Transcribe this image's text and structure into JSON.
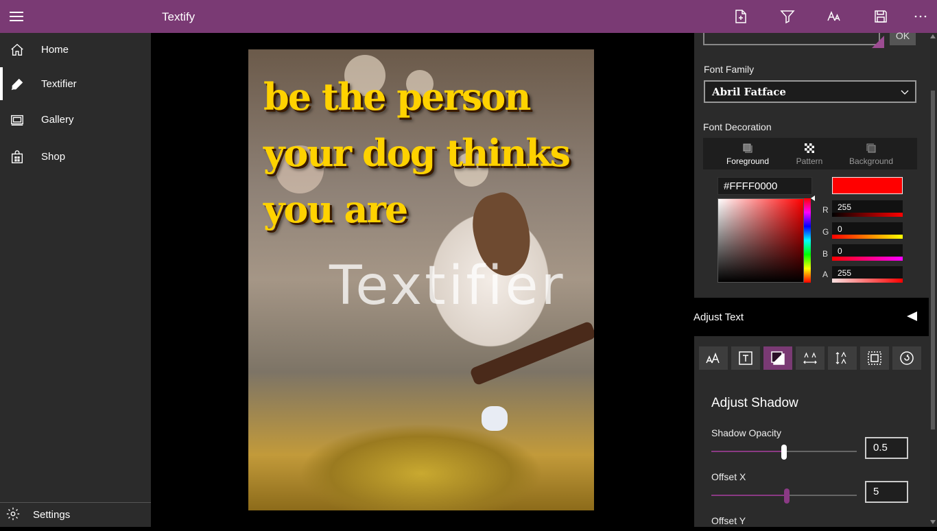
{
  "titlebar": {
    "app_title": "Textify",
    "actions": [
      "new-file-icon",
      "filter-icon",
      "text-style-icon",
      "save-icon",
      "more-icon"
    ],
    "color": "#7a3a74"
  },
  "sidebar": {
    "items": [
      {
        "label": "Home",
        "icon": "home-icon"
      },
      {
        "label": "Textifier",
        "icon": "pen-icon",
        "active": true
      },
      {
        "label": "Gallery",
        "icon": "gallery-icon"
      },
      {
        "label": "Shop",
        "icon": "shop-icon"
      }
    ],
    "settings_label": "Settings"
  },
  "canvas": {
    "quote_lines": [
      "be the person",
      "your dog thinks",
      "you are"
    ],
    "watermark": "Textifier"
  },
  "panel": {
    "ok_label": "OK",
    "font_family_label": "Font Family",
    "font_family_value": "Abril Fatface",
    "font_decoration_label": "Font Decoration",
    "decoration_tabs": [
      {
        "label": "Foreground",
        "active": true
      },
      {
        "label": "Pattern"
      },
      {
        "label": "Background"
      }
    ],
    "hex_value": "#FFFF0000",
    "swatch_color": "#ff0000",
    "channels": [
      {
        "label": "R",
        "value": "255"
      },
      {
        "label": "G",
        "value": "0"
      },
      {
        "label": "B",
        "value": "0"
      },
      {
        "label": "A",
        "value": "255"
      }
    ],
    "adjust_text_label": "Adjust Text",
    "tools": [
      "font-size-icon",
      "text-box-icon",
      "shadow-icon",
      "letter-spacing-icon",
      "line-spacing-icon",
      "border-icon",
      "rotate-icon"
    ],
    "active_tool_index": 2,
    "section_title": "Adjust Shadow",
    "shadow_opacity_label": "Shadow Opacity",
    "shadow_opacity_value": "0.5",
    "shadow_opacity_level": 0.5,
    "offset_x_label": "Offset X",
    "offset_x_value": "5",
    "offset_x_level": 0.52,
    "offset_y_label": "Offset Y",
    "accent_color": "#7a3a74"
  }
}
